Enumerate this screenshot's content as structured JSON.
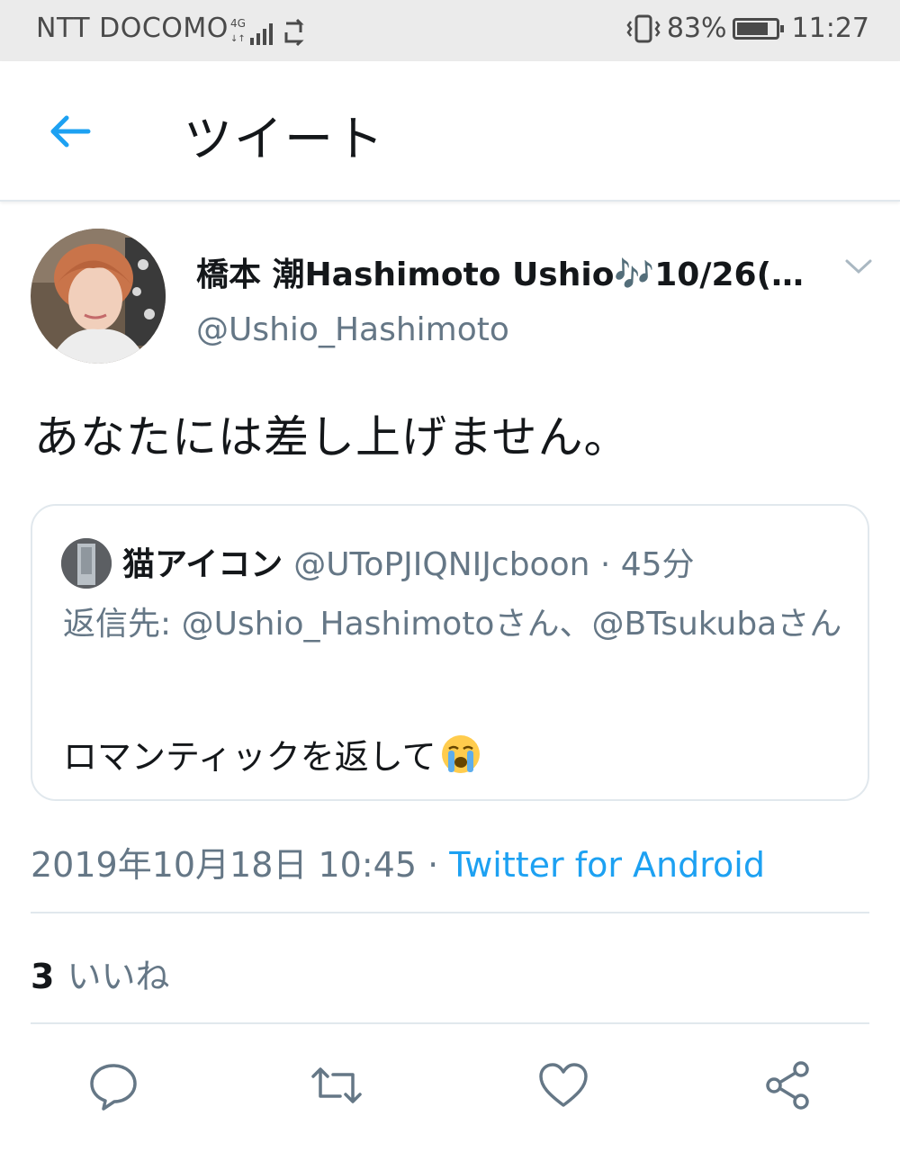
{
  "status_bar": {
    "carrier": "NTT DOCOMO",
    "network": "4G",
    "battery_percent": "83%",
    "battery_level": 0.83,
    "time": "11:27"
  },
  "header": {
    "title": "ツイート",
    "back_icon": "back-arrow-icon"
  },
  "tweet": {
    "display_name": "橋本 潮Hashimoto Ushio🎶10/26(…",
    "handle": "@Ushio_Hashimoto",
    "text": "あなたには差し上げません。",
    "timestamp": "2019年10月18日 10:45",
    "separator": " · ",
    "source": "Twitter for Android",
    "likes_count": "3",
    "likes_label": "いいね"
  },
  "quoted_tweet": {
    "display_name": "猫アイコン",
    "handle_time": "@UToPJIQNIJcboon · 45分",
    "reply_to": "返信先: @Ushio_Hashimotoさん、@BTsukubaさん",
    "text": "ロマンティックを返して"
  },
  "actions": {
    "reply_icon": "reply-icon",
    "retweet_icon": "retweet-icon",
    "like_icon": "heart-icon",
    "share_icon": "share-icon"
  },
  "colors": {
    "accent": "#1da1f2",
    "secondary_text": "#657786",
    "border": "#e1e8ed"
  }
}
